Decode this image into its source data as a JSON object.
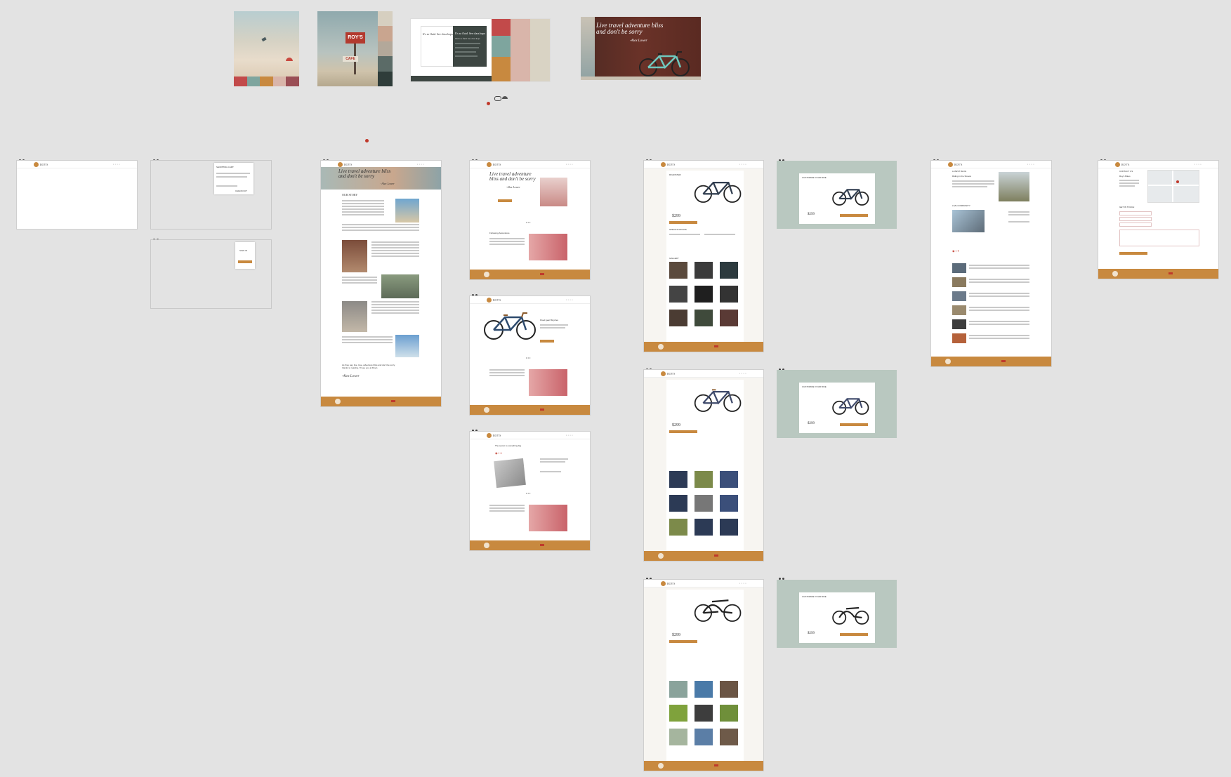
{
  "app": {
    "name": "ROY'S",
    "tagline": "Live travel adventure bliss and don't be sorry",
    "signature": "-Alex Lower"
  },
  "moodboard": {
    "roys_sign": "ROY'S",
    "cafe_sign": "CAFE",
    "hero_quote": "Live travel adventure bliss and don't be sorry",
    "hero_signature": "-Alex Lower",
    "type_sample_title": "It's so fluid. See class hops",
    "type_sample_dark_title": "It's so fluid. See class hops",
    "type_sample_subtitle": "We're so fluid. See class hops"
  },
  "nav": {
    "logo": "ROY'S",
    "links": [
      "BICYCLE",
      "ABOUT",
      "ACCESSORIES",
      "CONTACT US"
    ]
  },
  "pages": {
    "about": {
      "banner_quote": "Live travel adventure bliss and don't be sorry",
      "banner_signature": "-Alex Lower",
      "heading": "OUR STORY",
      "sections": [
        "About us",
        "Our Bicycles",
        "Our Workshop",
        "Our Location"
      ],
      "closing": "As they say, live, love, adventure bliss and don't be sorry. thanks to reading, I'll see you at Roy's.",
      "signature": "-Alex Lower"
    },
    "home": {
      "hero_quote": "Live travel adventure bliss and don't be sorry",
      "hero_signature": "-Alex Lower",
      "hero_button": "SHOP NOW",
      "feature_title": "Fixed gear Bicycles",
      "blog_title": "The secret to something big",
      "section_label": "Following Adventures"
    },
    "product": {
      "tabs": [
        "ROAD",
        "FIXED",
        "CRUISER"
      ],
      "title": "ROADSTER",
      "price": "$299",
      "price_cents": "00",
      "button": "ADD TO CART",
      "features": "SPECIFICATIONS",
      "gallery": "GALLERY"
    },
    "modal": {
      "title": "CUSTOMIZE YOUR BIKE",
      "price": "$299",
      "price_cents": "00",
      "button": "ADD TO CART"
    },
    "blog": {
      "title": "LATEST BLOG",
      "featured": "Riding in the Streets",
      "section": "LIVE COMMUNITY",
      "older": "OLDER POSTS"
    },
    "contact": {
      "title": "CONTACT US",
      "store": "Roy's Bikes",
      "form_title": "GET IN TOUCH",
      "submit": "SUBMIT"
    },
    "cart": {
      "title": "SHOPPING CART",
      "checkout": "CHECKOUT"
    },
    "popup": {
      "title": "SIGN IN",
      "button": "SUBMIT"
    }
  },
  "colors": {
    "gold": "#c8893f",
    "red": "#c24a4a",
    "teal": "#7ea59e",
    "blush": "#d9b5aa",
    "cream": "#d9d3c4",
    "charcoal": "#3d4642",
    "sage": "#b9c8c0",
    "brick": "#5c2d24"
  }
}
